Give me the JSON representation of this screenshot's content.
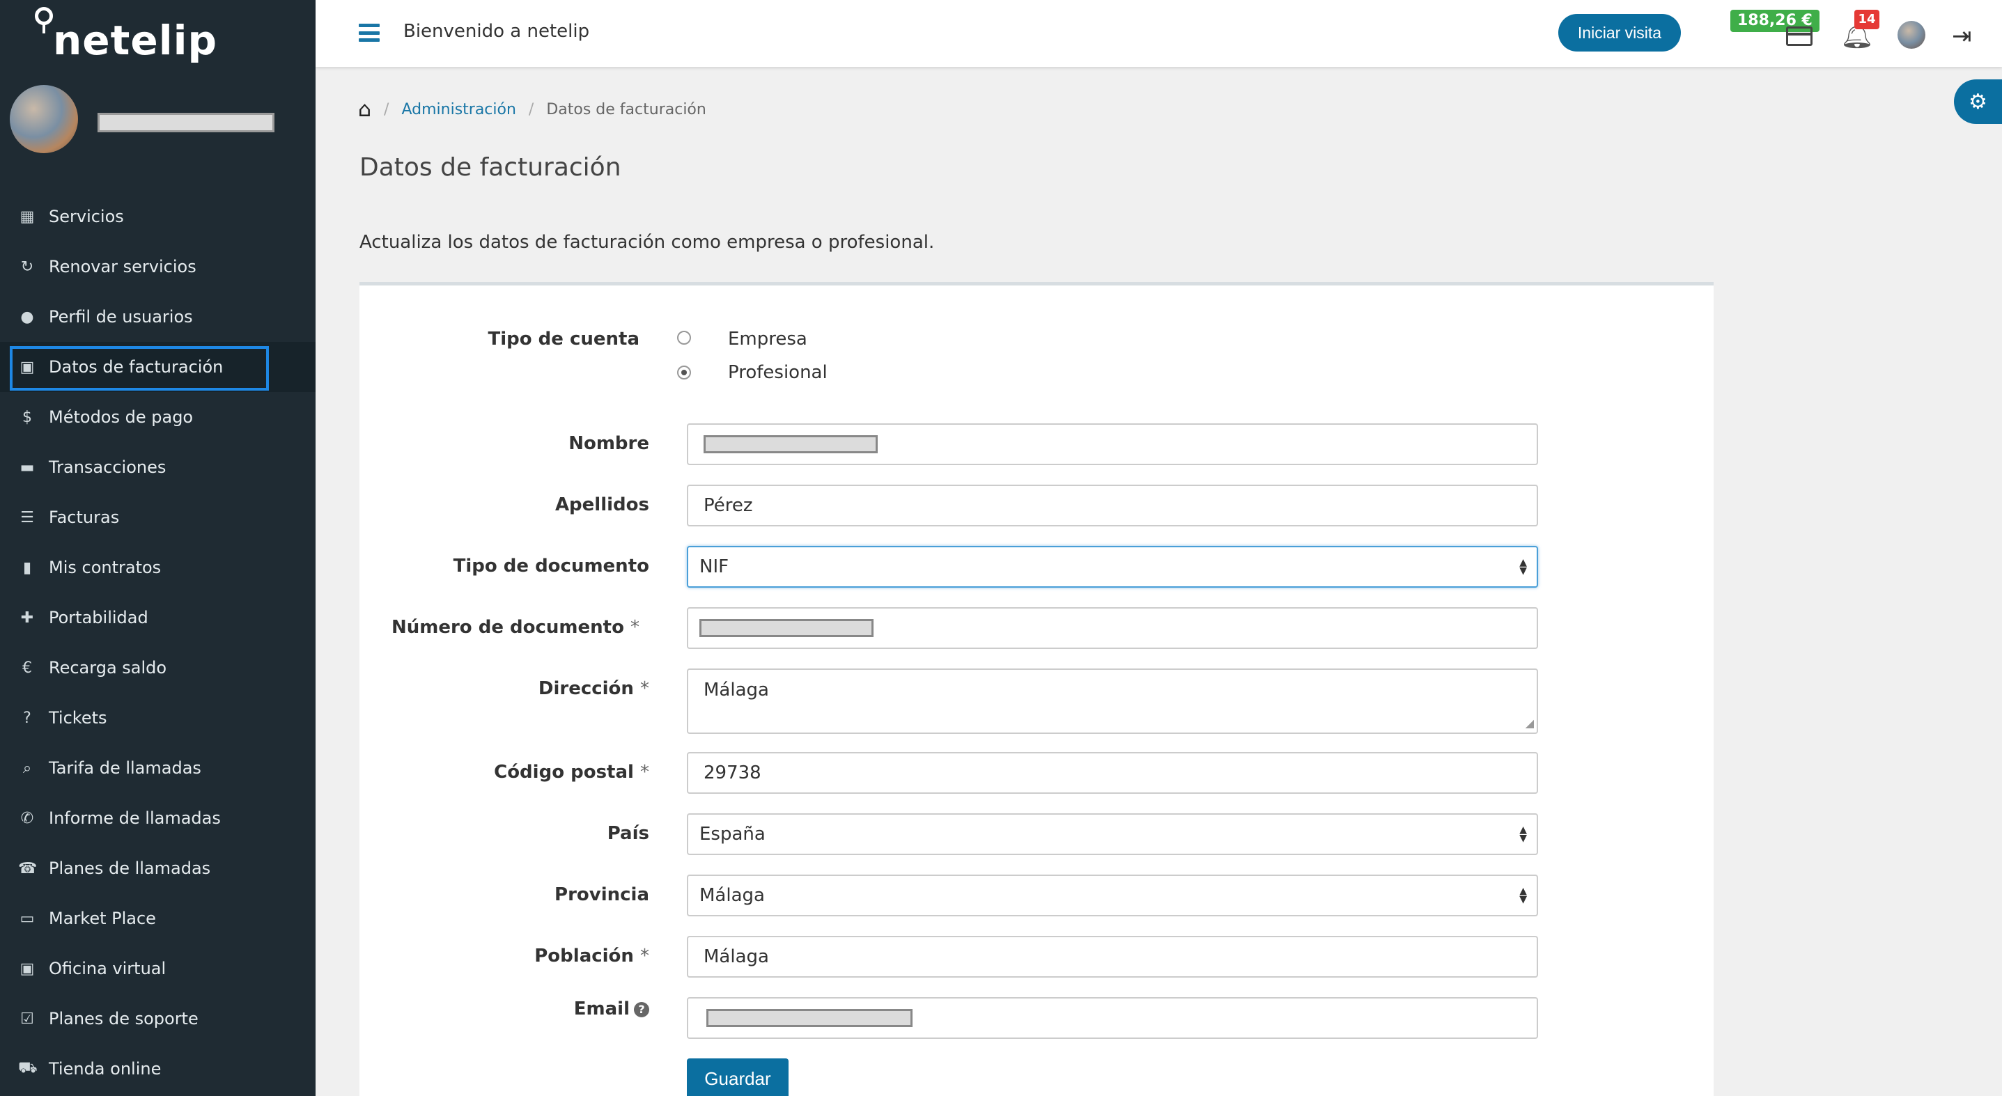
{
  "app": {
    "brand": "netelip"
  },
  "topbar": {
    "welcome": "Bienvenido a netelip",
    "visit_button": "Iniciar visita",
    "balance": "188,26 €",
    "notifications_count": "14"
  },
  "sidebar": {
    "items": [
      {
        "label": "Servicios",
        "icon": "grid-icon"
      },
      {
        "label": "Renovar servicios",
        "icon": "refresh-icon"
      },
      {
        "label": "Perfil de usuarios",
        "icon": "user-icon"
      },
      {
        "label": "Datos de facturación",
        "icon": "briefcase-icon",
        "active": true
      },
      {
        "label": "Métodos de pago",
        "icon": "dollar-icon"
      },
      {
        "label": "Transacciones",
        "icon": "credit-card-icon"
      },
      {
        "label": "Facturas",
        "icon": "list-icon"
      },
      {
        "label": "Mis contratos",
        "icon": "document-icon"
      },
      {
        "label": "Portabilidad",
        "icon": "plus-icon"
      },
      {
        "label": "Recarga saldo",
        "icon": "euro-icon"
      },
      {
        "label": "Tickets",
        "icon": "question-icon"
      },
      {
        "label": "Tarifa de llamadas",
        "icon": "search-icon"
      },
      {
        "label": "Informe de llamadas",
        "icon": "phone-icon"
      },
      {
        "label": "Planes de llamadas",
        "icon": "telephone-icon"
      },
      {
        "label": "Market Place",
        "icon": "monitor-icon"
      },
      {
        "label": "Oficina virtual",
        "icon": "briefcase-icon"
      },
      {
        "label": "Planes de soporte",
        "icon": "check-square-icon"
      },
      {
        "label": "Tienda online",
        "icon": "cart-icon"
      }
    ]
  },
  "breadcrumb": {
    "level1": "Administración",
    "current": "Datos de facturación"
  },
  "page": {
    "title": "Datos de facturación",
    "subtitle": "Actualiza los datos de facturación como empresa o profesional."
  },
  "form": {
    "account_type": {
      "label": "Tipo de cuenta",
      "options": [
        "Empresa",
        "Profesional"
      ],
      "selected": "Profesional"
    },
    "nombre": {
      "label": "Nombre"
    },
    "apellidos": {
      "label": "Apellidos",
      "value": "Pérez"
    },
    "tipo_documento": {
      "label": "Tipo de documento",
      "value": "NIF"
    },
    "numero_documento": {
      "label": "Número de documento"
    },
    "direccion": {
      "label": "Dirección",
      "value": "Málaga"
    },
    "codigo_postal": {
      "label": "Código postal",
      "value": "29738"
    },
    "pais": {
      "label": "País",
      "value": "España"
    },
    "provincia": {
      "label": "Provincia",
      "value": "Málaga"
    },
    "poblacion": {
      "label": "Población",
      "value": "Málaga"
    },
    "email": {
      "label": "Email"
    },
    "required_mark": "*",
    "save_label": "Guardar"
  },
  "colors": {
    "sidebar_bg": "#1f2b33",
    "accent": "#0b6fa0",
    "balance": "#3fae49",
    "badge": "#e53935"
  }
}
